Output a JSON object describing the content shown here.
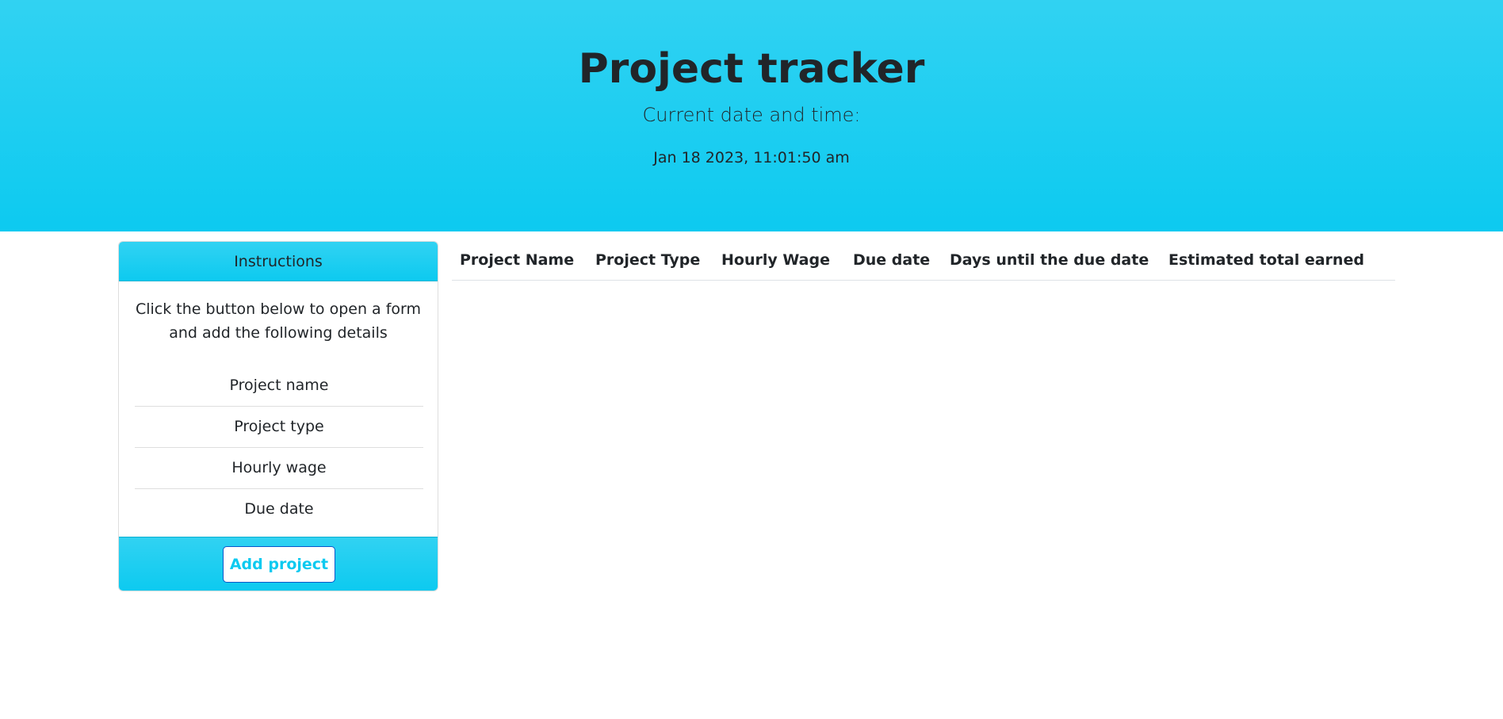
{
  "header": {
    "title": "Project tracker",
    "subtitle": "Current date and time:",
    "datetime": "Jan 18 2023, 11:01:50 am"
  },
  "instructions": {
    "title": "Instructions",
    "text": "Click the button below to open a form and add the following details",
    "items": [
      "Project name",
      "Project type",
      "Hourly wage",
      "Due date"
    ],
    "button_label": "Add project"
  },
  "table": {
    "columns": [
      "Project Name",
      "Project Type",
      "Hourly Wage",
      "Due date",
      "Days until the due date",
      "Estimated total earned"
    ],
    "rows": []
  },
  "colors": {
    "accent": "#0dcaf0",
    "accent_light": "#31d2f2",
    "text": "#212529"
  }
}
